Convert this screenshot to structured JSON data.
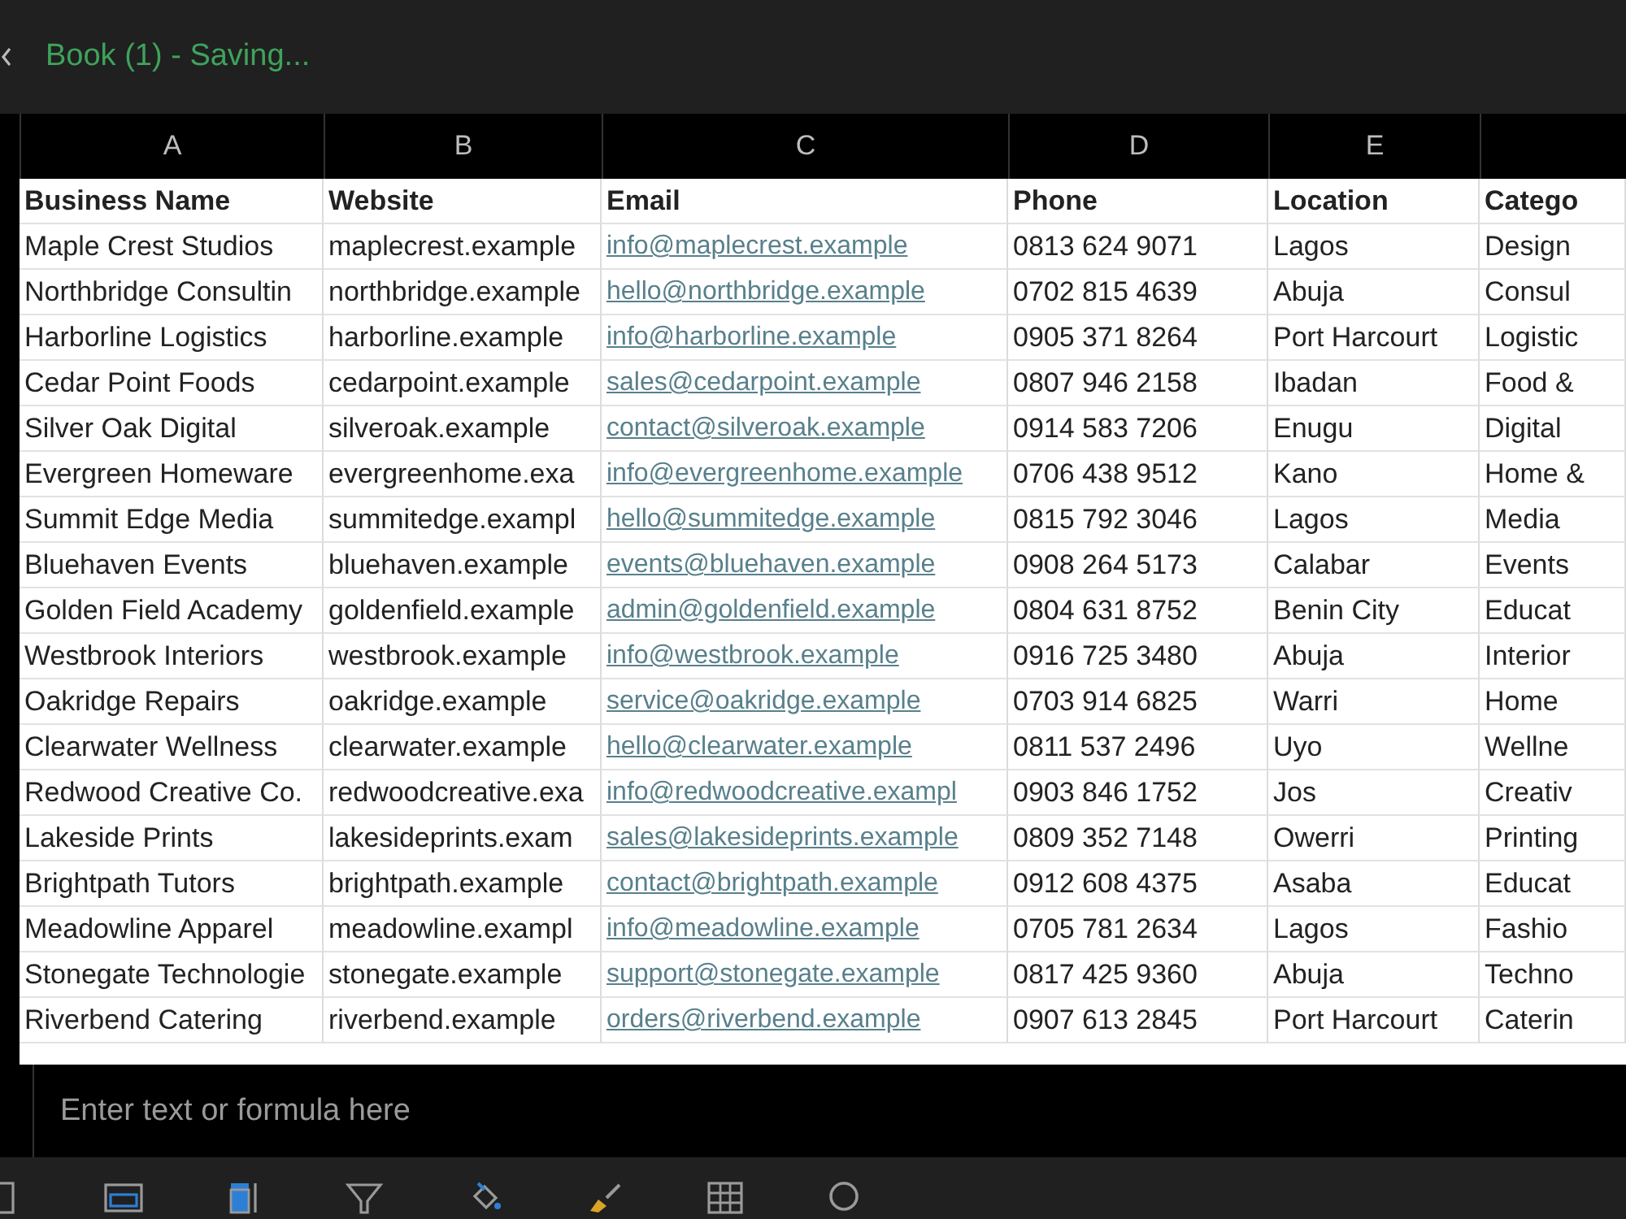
{
  "window": {
    "title": "Book (1) - Saving..."
  },
  "table": {
    "columns": [
      {
        "letter": "A",
        "heading": "Business Name",
        "kind": "text"
      },
      {
        "letter": "B",
        "heading": "Website",
        "kind": "text"
      },
      {
        "letter": "C",
        "heading": "Email",
        "kind": "link"
      },
      {
        "letter": "D",
        "heading": "Phone",
        "kind": "text"
      },
      {
        "letter": "E",
        "heading": "Location",
        "kind": "text"
      },
      {
        "heading": "Catego",
        "kind": "text"
      }
    ],
    "rows": [
      [
        "Maple Crest Studios",
        "maplecrest.example",
        "info@maplecrest.example",
        "0813 624 9071",
        "Lagos",
        "Design"
      ],
      [
        "Northbridge Consultin",
        "northbridge.example",
        "hello@northbridge.example",
        "0702 815 4639",
        "Abuja",
        "Consul"
      ],
      [
        "Harborline Logistics",
        "harborline.example",
        "info@harborline.example",
        "0905 371 8264",
        "Port Harcourt",
        "Logistic"
      ],
      [
        "Cedar Point Foods",
        "cedarpoint.example",
        "sales@cedarpoint.example",
        "0807 946 2158",
        "Ibadan",
        "Food &"
      ],
      [
        "Silver Oak Digital",
        "silveroak.example",
        "contact@silveroak.example",
        "0914 583 7206",
        "Enugu",
        "Digital"
      ],
      [
        "Evergreen Homeware",
        "evergreenhome.exa",
        "info@evergreenhome.example",
        "0706 438 9512",
        "Kano",
        "Home &"
      ],
      [
        "Summit Edge Media",
        "summitedge.exampl",
        "hello@summitedge.example",
        "0815 792 3046",
        "Lagos",
        "Media"
      ],
      [
        "Bluehaven Events",
        "bluehaven.example",
        "events@bluehaven.example",
        "0908 264 5173",
        "Calabar",
        "Events"
      ],
      [
        "Golden Field Academy",
        "goldenfield.example",
        "admin@goldenfield.example",
        "0804 631 8752",
        "Benin City",
        "Educat"
      ],
      [
        "Westbrook Interiors",
        "westbrook.example",
        "info@westbrook.example",
        "0916 725 3480",
        "Abuja",
        "Interior"
      ],
      [
        "Oakridge Repairs",
        "oakridge.example",
        "service@oakridge.example",
        "0703 914 6825",
        "Warri",
        "Home"
      ],
      [
        "Clearwater Wellness",
        "clearwater.example",
        "hello@clearwater.example",
        "0811 537 2496",
        "Uyo",
        "Wellne"
      ],
      [
        "Redwood Creative Co.",
        "redwoodcreative.exa",
        "info@redwoodcreative.exampl",
        "0903 846 1752",
        "Jos",
        "Creativ"
      ],
      [
        "Lakeside Prints",
        "lakesideprints.exam",
        "sales@lakesideprints.example",
        "0809 352 7148",
        "Owerri",
        "Printing"
      ],
      [
        "Brightpath Tutors",
        "brightpath.example",
        "contact@brightpath.example",
        "0912 608 4375",
        "Asaba",
        "Educat"
      ],
      [
        "Meadowline Apparel",
        "meadowline.exampl",
        "info@meadowline.example",
        "0705 781 2634",
        "Lagos",
        "Fashio"
      ],
      [
        "Stonegate Technologie",
        "stonegate.example",
        "support@stonegate.example",
        "0817 425 9360",
        "Abuja",
        "Techno"
      ],
      [
        "Riverbend Catering",
        "riverbend.example",
        "orders@riverbend.example",
        "0907 613 2845",
        "Port Harcourt",
        "Caterin"
      ]
    ]
  },
  "formula_bar": {
    "placeholder": "Enter text or formula here"
  }
}
